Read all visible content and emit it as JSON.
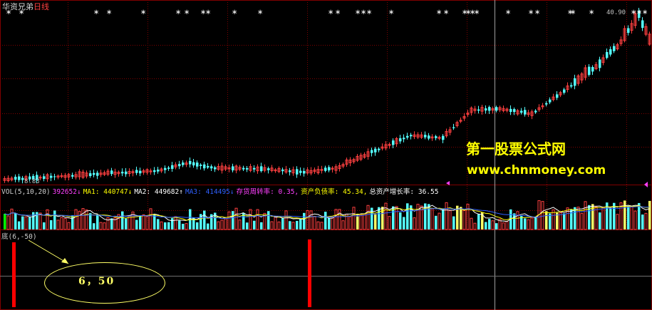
{
  "title": {
    "name": "华资兄弟",
    "period": "日线"
  },
  "price_labels": {
    "high": "40.90",
    "low": "8.83"
  },
  "volume_legend": [
    {
      "text": "VOL(5,10,20)",
      "color": "#d0d0d0"
    },
    {
      "text": "392652↓",
      "color": "#ff40ff"
    },
    {
      "text": "MA1: 440747↓",
      "color": "#ffff00"
    },
    {
      "text": "MA2: 449682↑",
      "color": "#ffffff"
    },
    {
      "text": "MA3: 414495↓",
      "color": "#3060ff"
    },
    {
      "text": "存货周转率: 0.35,",
      "color": "#ff40ff"
    },
    {
      "text": "资产负债率: 45.34,",
      "color": "#ffff00"
    },
    {
      "text": "总资产增长率: 36.55",
      "color": "#ffffff"
    }
  ],
  "indicator_label": "底(6,-50)",
  "annotation_text": "6，50",
  "watermark": {
    "line1": "第一股票公式网",
    "line2": "www.chnmoney.com"
  },
  "colors": {
    "up": "#ff4040",
    "down": "#54ffff",
    "grid": "#800000",
    "signal": "#ff0000",
    "annotation": "#ffff66"
  }
}
